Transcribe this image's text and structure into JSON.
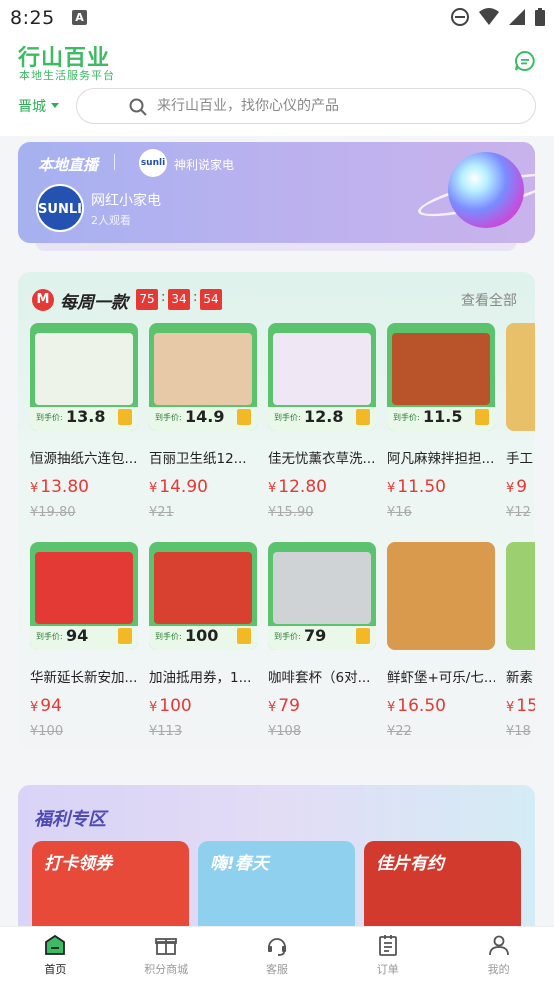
{
  "status_bar": {
    "time": "8:25",
    "notif_letter": "A"
  },
  "header": {
    "app_name": "行山百业",
    "app_slogan": "本地生活服务平台",
    "city": "晋城",
    "search_placeholder": "来行山百业，找你心仪的产品"
  },
  "live": {
    "title": "本地直播",
    "channel_logo": "sunli",
    "channel_name": "神利说家电",
    "streamer_logo": "SUNLI",
    "streamer_name": "网红小家电",
    "viewers": "2人观看"
  },
  "weekly": {
    "badge": "M",
    "title": "每周一款",
    "countdown": [
      "75",
      "34",
      "54"
    ],
    "view_all": "查看全部",
    "arrive_label": "到手价:",
    "row1": [
      {
        "name": "恒源抽纸六连包...",
        "arrive_price": "13.8",
        "price": "13.80",
        "original": "¥19.80",
        "bg": "#eef3ea"
      },
      {
        "name": "百丽卫生纸12...",
        "arrive_price": "14.9",
        "price": "14.90",
        "original": "¥21",
        "bg": "#e7c9a8"
      },
      {
        "name": "佳无忧薰衣草洗...",
        "arrive_price": "12.8",
        "price": "12.80",
        "original": "¥15.90",
        "bg": "#efe8f4"
      },
      {
        "name": "阿凡麻辣拌担担...",
        "arrive_price": "11.5",
        "price": "11.50",
        "original": "¥16",
        "bg": "#b8532a"
      },
      {
        "name": "手工",
        "arrive_price": "",
        "price": "9",
        "original": "¥12",
        "bg": "#e9c06a"
      }
    ],
    "row2": [
      {
        "name": "华新延长新安加...",
        "arrive_price": "94",
        "price": "94",
        "original": "¥100",
        "bg": "#e43a36"
      },
      {
        "name": "加油抵用券，1...",
        "arrive_price": "100",
        "price": "100",
        "original": "¥113",
        "bg": "#d8412f"
      },
      {
        "name": "咖啡套杯（6对...",
        "arrive_price": "79",
        "price": "79",
        "original": "¥108",
        "bg": "#cfd3d6"
      },
      {
        "name": "鲜虾堡+可乐/七...",
        "arrive_price": "",
        "price": "16.50",
        "original": "¥22",
        "bg": "#d99a4e"
      },
      {
        "name": "新素",
        "arrive_price": "",
        "price": "15",
        "original": "¥18",
        "bg": "#9ccf70"
      }
    ]
  },
  "benefit": {
    "title": "福利专区",
    "cards": [
      {
        "label": "打卡领券",
        "bg": "#e84a3a"
      },
      {
        "label": "嗨!春天",
        "bg": "#8fd0ee"
      },
      {
        "label": "佳片有约",
        "bg": "#d23a2e"
      }
    ]
  },
  "nav": [
    {
      "label": "首页",
      "icon": "home-icon",
      "active": true
    },
    {
      "label": "积分商城",
      "icon": "gift-icon",
      "active": false
    },
    {
      "label": "客服",
      "icon": "headset-icon",
      "active": false
    },
    {
      "label": "订单",
      "icon": "order-icon",
      "active": false
    },
    {
      "label": "我的",
      "icon": "user-icon",
      "active": false
    }
  ],
  "colors": {
    "brand_green": "#3dbb62",
    "price_red": "#e53935",
    "countdown_red": "#e53935"
  }
}
